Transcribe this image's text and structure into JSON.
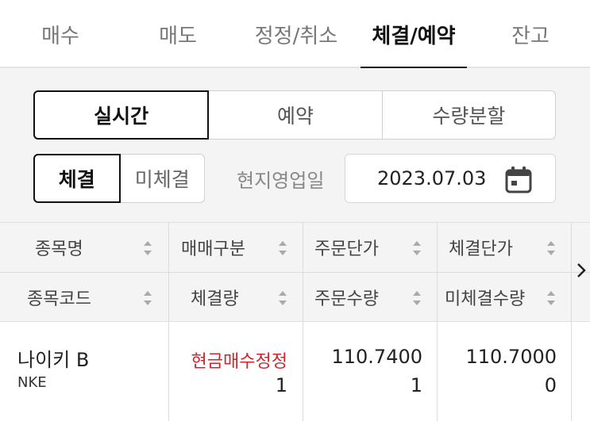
{
  "tabs": [
    {
      "label": "매수",
      "active": false
    },
    {
      "label": "매도",
      "active": false
    },
    {
      "label": "정정/취소",
      "active": false
    },
    {
      "label": "체결/예약",
      "active": true
    },
    {
      "label": "잔고",
      "active": false
    }
  ],
  "mode_segment": {
    "options": [
      "실시간",
      "예약",
      "수량분할"
    ],
    "selected": "실시간"
  },
  "status_segment": {
    "options": [
      "체결",
      "미체결"
    ],
    "selected": "체결"
  },
  "date_filter": {
    "label": "현지영업일",
    "value": "2023.07.03",
    "icon": "calendar-icon"
  },
  "table": {
    "header_row1": [
      "종목명",
      "매매구분",
      "주문단가",
      "체결단가"
    ],
    "header_row2": [
      "종목코드",
      "체결량",
      "주문수량",
      "미체결수량"
    ],
    "rows": [
      {
        "name": "나이키 B",
        "code": "NKE",
        "trade_type": "현금매수정정",
        "filled_qty": "1",
        "order_price": "110.7400",
        "order_qty": "1",
        "fill_price": "110.7000",
        "unfilled_qty": "0"
      }
    ]
  },
  "colors": {
    "accent": "#111111",
    "buy_red": "#c8282f",
    "panel_bg": "#f4f4f4"
  }
}
